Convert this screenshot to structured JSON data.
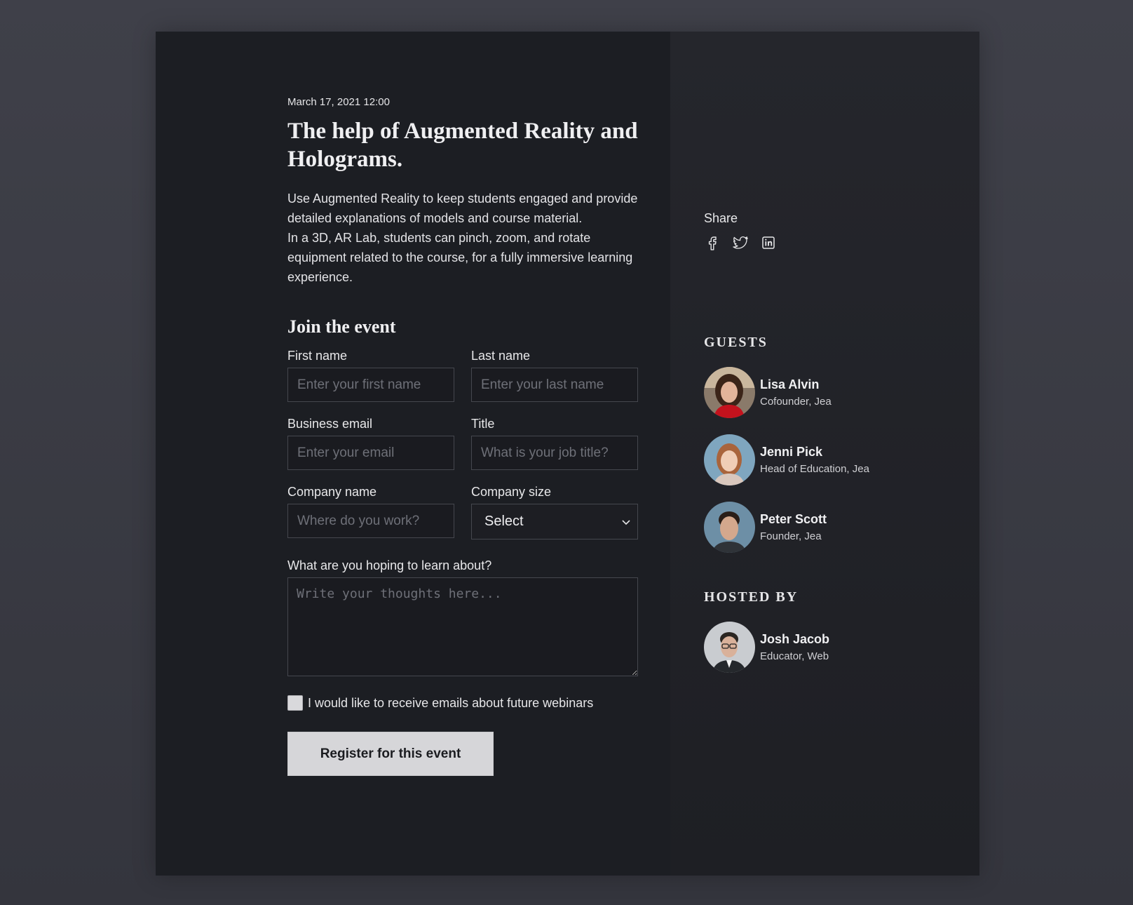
{
  "event": {
    "date": "March 17, 2021 12:00",
    "title": "The help of Augmented Reality and Holograms.",
    "description_1": "Use Augmented Reality to keep students engaged and provide detailed explanations of models and course material.",
    "description_2": "In a 3D, AR Lab, students can pinch, zoom, and rotate equipment related to the course, for a fully immersive learning experience."
  },
  "form": {
    "heading": "Join the event",
    "first_name": {
      "label": "First name",
      "placeholder": "Enter your first name",
      "value": ""
    },
    "last_name": {
      "label": "Last name",
      "placeholder": "Enter your last name",
      "value": ""
    },
    "email": {
      "label": "Business email",
      "placeholder": "Enter your email",
      "value": ""
    },
    "job_title": {
      "label": "Title",
      "placeholder": "What is your job title?",
      "value": ""
    },
    "company": {
      "label": "Company name",
      "placeholder": "Where do you work?",
      "value": ""
    },
    "company_size": {
      "label": "Company size",
      "selected": "Select"
    },
    "learn": {
      "label": "What are you hoping to learn about?",
      "placeholder": "Write your thoughts here..."
    },
    "newsletter": {
      "label": "I would like to receive emails about future webinars",
      "checked": false
    },
    "submit_label": "Register for this event"
  },
  "share": {
    "label": "Share",
    "icons": [
      "facebook-icon",
      "twitter-icon",
      "linkedin-icon"
    ]
  },
  "guests": {
    "heading": "GUESTS",
    "people": [
      {
        "name": "Lisa Alvin",
        "role": "Cofounder, Jea"
      },
      {
        "name": "Jenni Pick",
        "role": "Head of Education, Jea"
      },
      {
        "name": "Peter Scott",
        "role": "Founder, Jea"
      }
    ]
  },
  "host": {
    "heading": "HOSTED BY",
    "name": "Josh Jacob",
    "role": "Educator, Web"
  }
}
